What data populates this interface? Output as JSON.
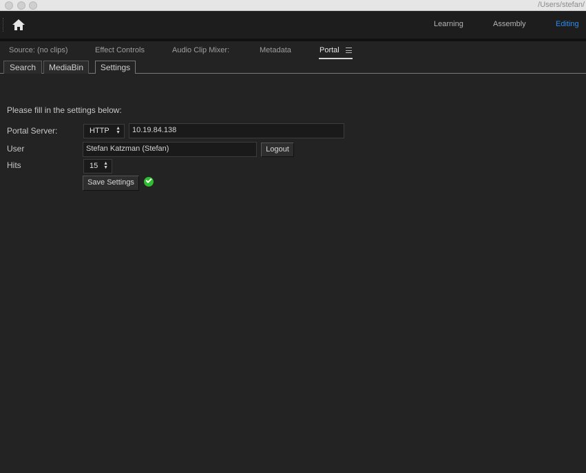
{
  "window": {
    "path": "/Users/stefan/"
  },
  "workspaces": [
    {
      "label": "Learning"
    },
    {
      "label": "Assembly"
    },
    {
      "label": "Editing",
      "active": true
    }
  ],
  "panel_tabs": [
    {
      "label": "Source: (no clips)"
    },
    {
      "label": "Effect Controls"
    },
    {
      "label": "Audio Clip Mixer:"
    },
    {
      "label": "Metadata"
    },
    {
      "label": "Portal",
      "active": true
    }
  ],
  "sub_tabs": [
    {
      "label": "Search"
    },
    {
      "label": "MediaBin"
    },
    {
      "label": "Settings",
      "active": true
    }
  ],
  "settings": {
    "intro": "Please fill in the settings below:",
    "portal_server_label": "Portal Server:",
    "protocol": "HTTP",
    "server_address": "10.19.84.138",
    "user_label": "User",
    "user_value": "Stefan Katzman (Stefan)",
    "logout_label": "Logout",
    "hits_label": "Hits",
    "hits_value": "15",
    "save_label": "Save Settings"
  },
  "colors": {
    "accent": "#2d8ceb",
    "success": "#2ebd2e"
  }
}
